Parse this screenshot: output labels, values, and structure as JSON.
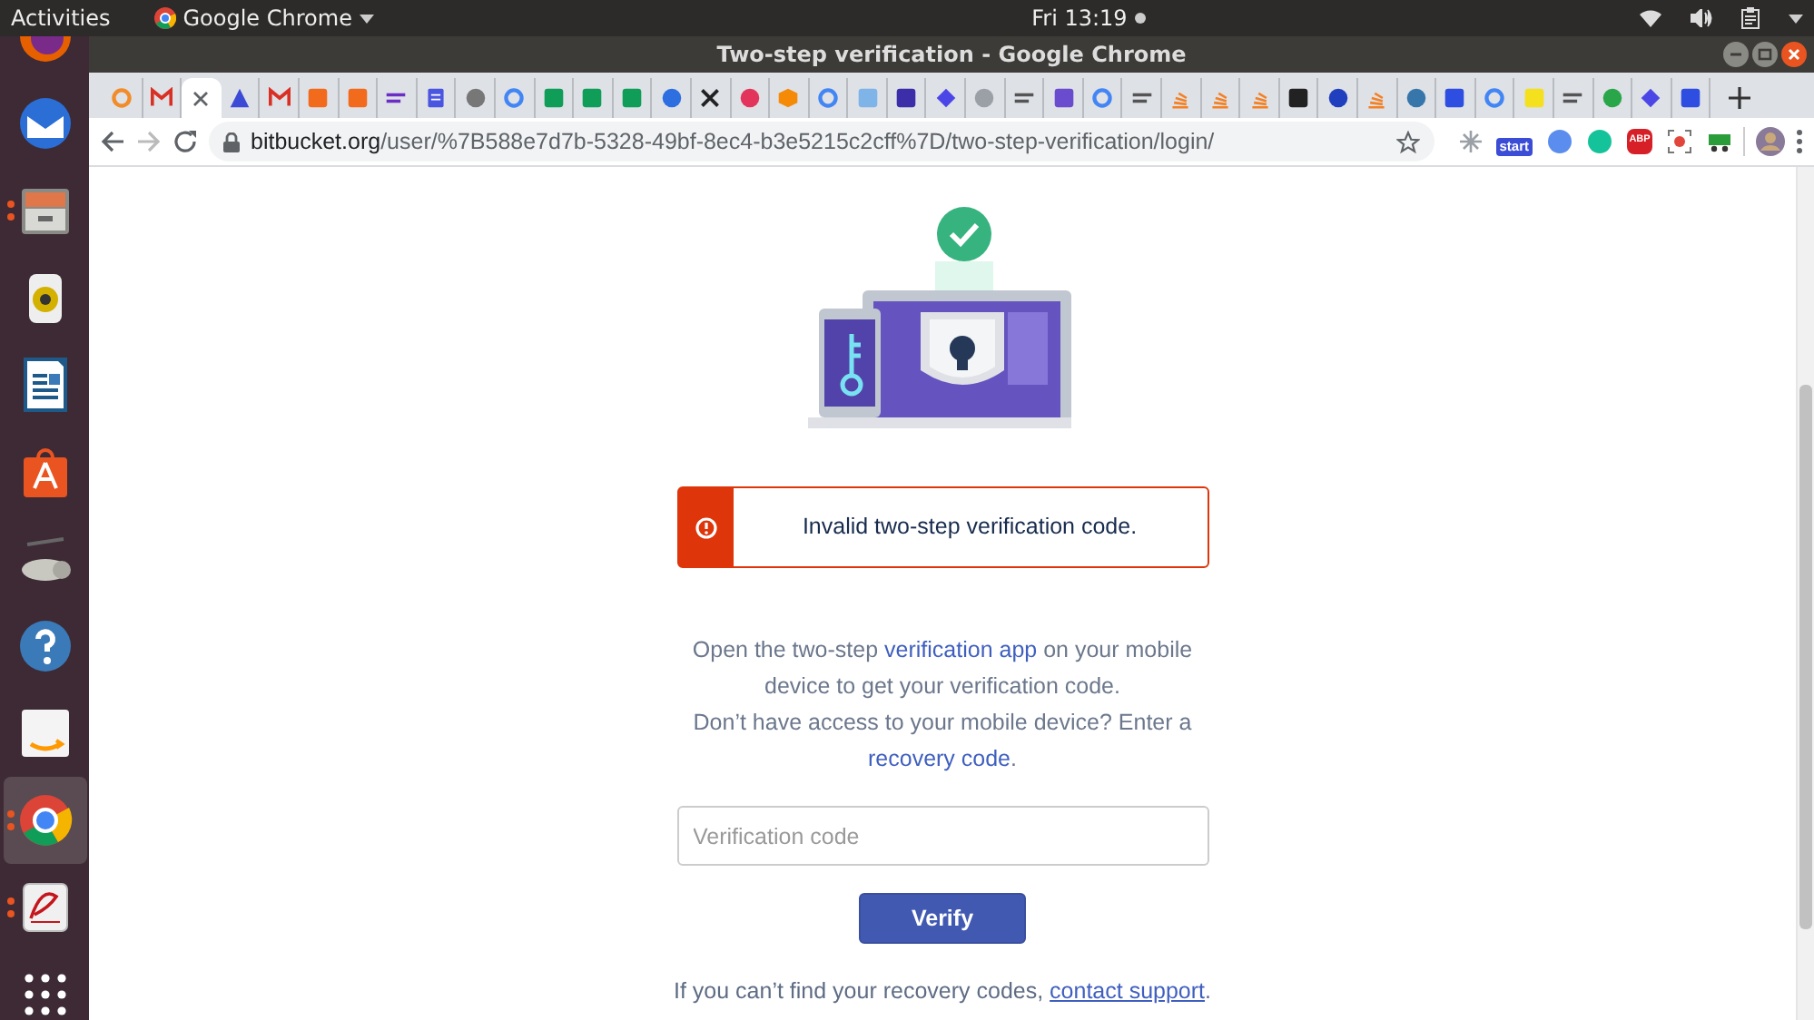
{
  "top_bar": {
    "activities": "Activities",
    "app": "Google Chrome",
    "clock": "Fri 13:19"
  },
  "dock": [
    {
      "kind": "globe",
      "running": false,
      "selected": false
    },
    {
      "kind": "mail",
      "running": false,
      "selected": false
    },
    {
      "kind": "drawer",
      "running": true,
      "selected": false
    },
    {
      "kind": "speaker",
      "running": false,
      "selected": false
    },
    {
      "kind": "document",
      "running": false,
      "selected": false
    },
    {
      "kind": "bag",
      "running": false,
      "selected": false
    },
    {
      "kind": "scanner",
      "running": false,
      "selected": false
    },
    {
      "kind": "help",
      "running": false,
      "selected": false
    },
    {
      "kind": "store",
      "running": false,
      "selected": false
    },
    {
      "kind": "browser",
      "running": true,
      "selected": true
    },
    {
      "kind": "reader",
      "running": true,
      "selected": false
    },
    {
      "kind": "grid",
      "running": false,
      "selected": false
    }
  ],
  "window": {
    "title": "Two-step verification - Google Chrome"
  },
  "tabs": [
    {
      "kind": "ring",
      "color": "#f28c28",
      "selected": false
    },
    {
      "kind": "mail",
      "color": "#d93025",
      "selected": false
    },
    {
      "color": "#5f6368",
      "selected": true
    },
    {
      "kind": "triangle",
      "color": "#3c4bd6",
      "selected": false
    },
    {
      "kind": "mail",
      "color": "#d93025",
      "selected": false
    },
    {
      "kind": "square",
      "color": "#f26b1d",
      "selected": false
    },
    {
      "kind": "square",
      "color": "#f26b1d",
      "selected": false
    },
    {
      "kind": "bars",
      "color": "#6c2dc7",
      "selected": false
    },
    {
      "kind": "document",
      "color": "#4a55e0",
      "selected": false
    },
    {
      "kind": "circle",
      "color": "#777777",
      "selected": false
    },
    {
      "kind": "ring",
      "color": "#4285f4",
      "selected": false
    },
    {
      "kind": "square",
      "color": "#0f9d58",
      "selected": false
    },
    {
      "kind": "square",
      "color": "#0f9d58",
      "selected": false
    },
    {
      "kind": "square",
      "color": "#0f9d58",
      "selected": false
    },
    {
      "kind": "circle",
      "color": "#2d6ee0",
      "selected": false
    },
    {
      "kind": "cross",
      "color": "#222222",
      "selected": false
    },
    {
      "kind": "circle",
      "color": "#e3345b",
      "selected": false
    },
    {
      "kind": "cube",
      "color": "#f58a07",
      "selected": false
    },
    {
      "kind": "ring",
      "color": "#4285f4",
      "selected": false
    },
    {
      "kind": "square",
      "color": "#7fb4e8",
      "selected": false
    },
    {
      "kind": "square",
      "color": "#3b2ea8",
      "selected": false
    },
    {
      "kind": "diamond",
      "color": "#4a47e6",
      "selected": false
    },
    {
      "kind": "circle",
      "color": "#9aa0a6",
      "selected": false
    },
    {
      "kind": "bars",
      "color": "#555555",
      "selected": false
    },
    {
      "kind": "square",
      "color": "#6a4ccf",
      "selected": false
    },
    {
      "kind": "ring",
      "color": "#4285f4",
      "selected": false
    },
    {
      "kind": "bars",
      "color": "#555555",
      "selected": false
    },
    {
      "kind": "stack",
      "color": "#f48024",
      "selected": false
    },
    {
      "kind": "stack",
      "color": "#f48024",
      "selected": false
    },
    {
      "kind": "stack",
      "color": "#f48024",
      "selected": false
    },
    {
      "kind": "square",
      "color": "#222222",
      "selected": false
    },
    {
      "kind": "circle",
      "color": "#1f3fbf",
      "selected": false
    },
    {
      "kind": "stack",
      "color": "#f48024",
      "selected": false
    },
    {
      "kind": "circle",
      "color": "#3776ab",
      "selected": false
    },
    {
      "kind": "square",
      "color": "#2d4ee0",
      "selected": false
    },
    {
      "kind": "ring",
      "color": "#4285f4",
      "selected": false
    },
    {
      "kind": "square",
      "color": "#f4e01c",
      "selected": false
    },
    {
      "kind": "bars",
      "color": "#555555",
      "selected": false
    },
    {
      "kind": "circle",
      "color": "#2aa64a",
      "selected": false
    },
    {
      "kind": "diamond",
      "color": "#4a47e6",
      "selected": false
    },
    {
      "kind": "square",
      "color": "#2d4ee0",
      "selected": false
    }
  ],
  "address_bar": {
    "host": "bitbucket.org",
    "path": "/user/%7B588e7d7b-5328-49bf-8ec4-b3e5215c2cff%7D/two-step-verification/login/"
  },
  "extensions": [
    {
      "kind": "snowflake",
      "color": "#9aa0a6"
    },
    {
      "kind": "badge",
      "color": "#3b4cd6",
      "label": "start"
    },
    {
      "kind": "circle",
      "color": "#5b8def"
    },
    {
      "kind": "circle",
      "color": "#15c39a"
    },
    {
      "kind": "octagon",
      "color": "#d61f26",
      "label": "ABP"
    },
    {
      "kind": "target",
      "color": "#e2453c"
    },
    {
      "kind": "cart",
      "color": "#2a9d3a"
    }
  ],
  "page": {
    "alert": "Invalid two-step verification code.",
    "instructions": [
      [
        {
          "text": "Open the two-step "
        },
        {
          "text": "verification app",
          "link": true
        },
        {
          "text": " on your mobile device to get your verification code."
        }
      ],
      [
        {
          "text": "Don’t have access to your mobile device? Enter a "
        },
        {
          "text": "recovery code",
          "link": true
        },
        {
          "text": "."
        }
      ]
    ],
    "field": {
      "placeholder": "Verification code"
    },
    "button": "Verify",
    "footer": [
      {
        "text": "If you can’t find your recovery codes, "
      },
      {
        "text": "contact support",
        "link": true,
        "underline": true
      },
      {
        "text": "."
      }
    ]
  }
}
